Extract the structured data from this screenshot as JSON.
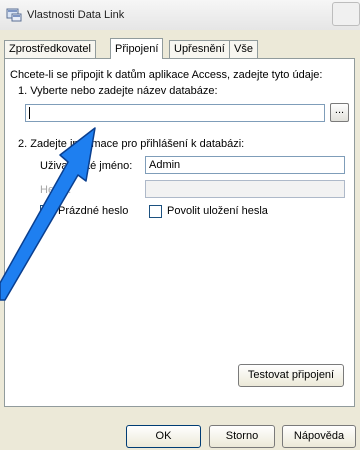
{
  "window": {
    "title": "Vlastnosti Data Link"
  },
  "tabs": [
    {
      "label": "Zprostředkovatel"
    },
    {
      "label": "Připojení"
    },
    {
      "label": "Upřesnění"
    },
    {
      "label": "Vše"
    }
  ],
  "connection": {
    "intro": "Chcete-li se připojit k datům aplikace Access, zadejte tyto údaje:",
    "step1": "1. Vyberte nebo zadejte název databáze:",
    "db_name_value": "",
    "browse_label": "...",
    "step2": "2. Zadejte informace pro přihlášení k databázi:",
    "username_label": "Uživatelské jméno:",
    "username_value": "Admin",
    "password_label": "Heslo:",
    "password_value": "",
    "blank_password_label": "Prázdné heslo",
    "blank_password_checked": true,
    "allow_saving_label": "Povolit uložení hesla",
    "allow_saving_checked": false,
    "test_button": "Testovat připojení"
  },
  "footer": {
    "ok": "OK",
    "cancel": "Storno",
    "help": "Nápověda"
  }
}
